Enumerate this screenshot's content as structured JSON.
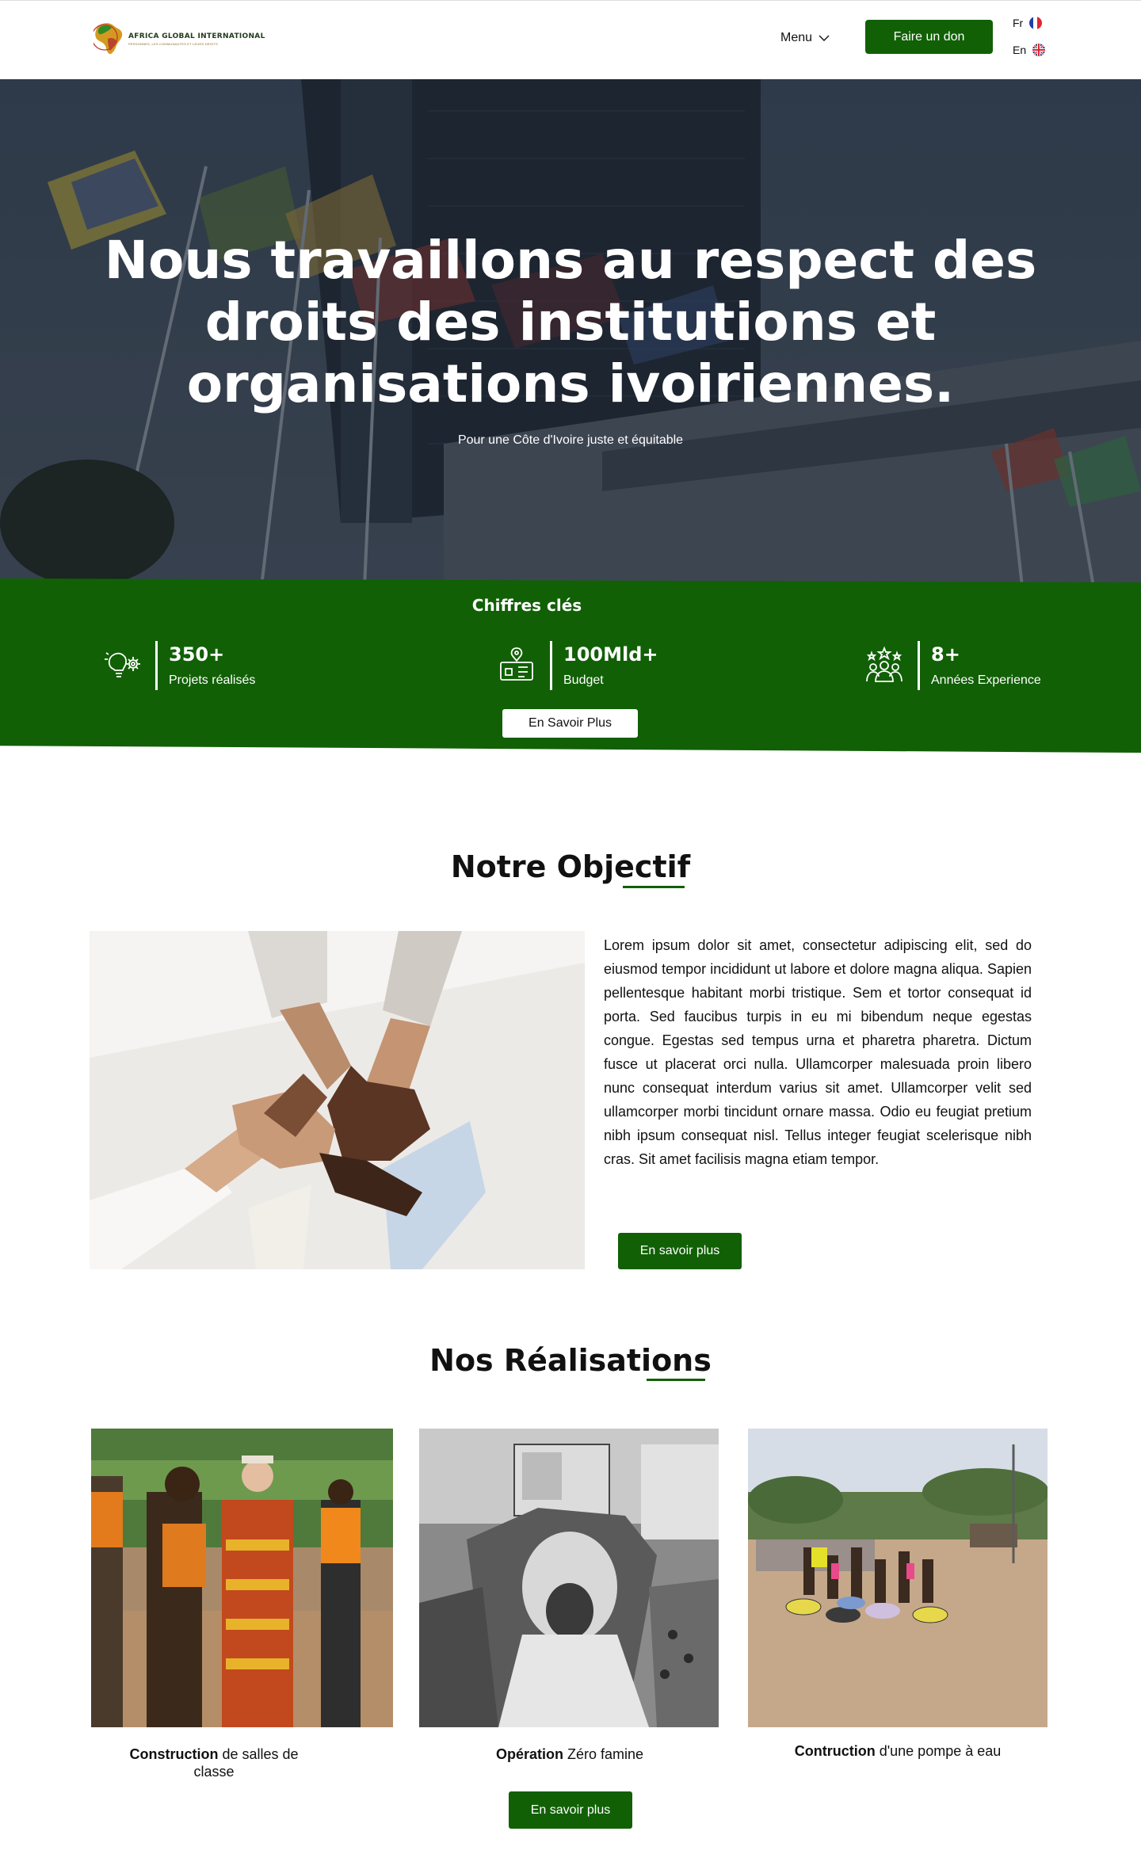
{
  "header": {
    "logo_name": "AFRICA GLOBAL INTERNATIONAL",
    "logo_tagline": "PERSONNES, LES COMMUNAUTES ET LEURS DROITS",
    "menu_label": "Menu",
    "donate_label": "Faire un don",
    "languages": [
      {
        "code": "Fr",
        "flag": "france-flag"
      },
      {
        "code": "En",
        "flag": "uk-flag"
      }
    ]
  },
  "hero": {
    "title": "Nous travaillons au respect  des\ndroits des institutions et\norganisations ivoiriennes.",
    "subtitle": "Pour une Côte d'Ivoire juste et équitable"
  },
  "stats": {
    "title": "Chiffres clés",
    "items": [
      {
        "value": "350+",
        "label": "Projets réalisés",
        "icon": "lightbulb-gear-icon"
      },
      {
        "value": "100Mld+",
        "label": "Budget",
        "icon": "budget-map-icon"
      },
      {
        "value": "8+",
        "label": "Années Experience",
        "icon": "team-stars-icon"
      }
    ],
    "button_label": "En Savoir Plus"
  },
  "objectif": {
    "title": "Notre Objectif",
    "text": "Lorem ipsum dolor sit amet, consectetur adipiscing elit, sed do eiusmod tempor incididunt ut labore et dolore magna aliqua. Sapien pellentesque habitant morbi tristique. Sem et tortor consequat id porta. Sed faucibus turpis in eu mi bibendum neque egestas congue. Egestas sed tempus urna et pharetra pharetra. Dictum fusce ut placerat orci nulla. Ullamcorper malesuada proin libero nunc consequat interdum varius sit amet. Ullamcorper velit sed ullamcorper morbi tincidunt ornare massa. Odio eu feugiat pretium nibh ipsum consequat nisl. Tellus integer feugiat scelerisque nibh cras. Sit amet facilisis magna etiam tempor.",
    "button_label": "En savoir plus"
  },
  "realisations": {
    "title": "Nos Réalisations",
    "cards": [
      {
        "bold": "Construction",
        "rest": " de salles de classe"
      },
      {
        "bold": "Opération",
        "rest": " Zéro famine"
      },
      {
        "bold": "Contruction",
        "rest": " d'une pompe à eau"
      }
    ],
    "button_label": "En savoir plus"
  },
  "colors": {
    "brand_green": "#116006",
    "hero_overlay": "#2d3a49"
  }
}
